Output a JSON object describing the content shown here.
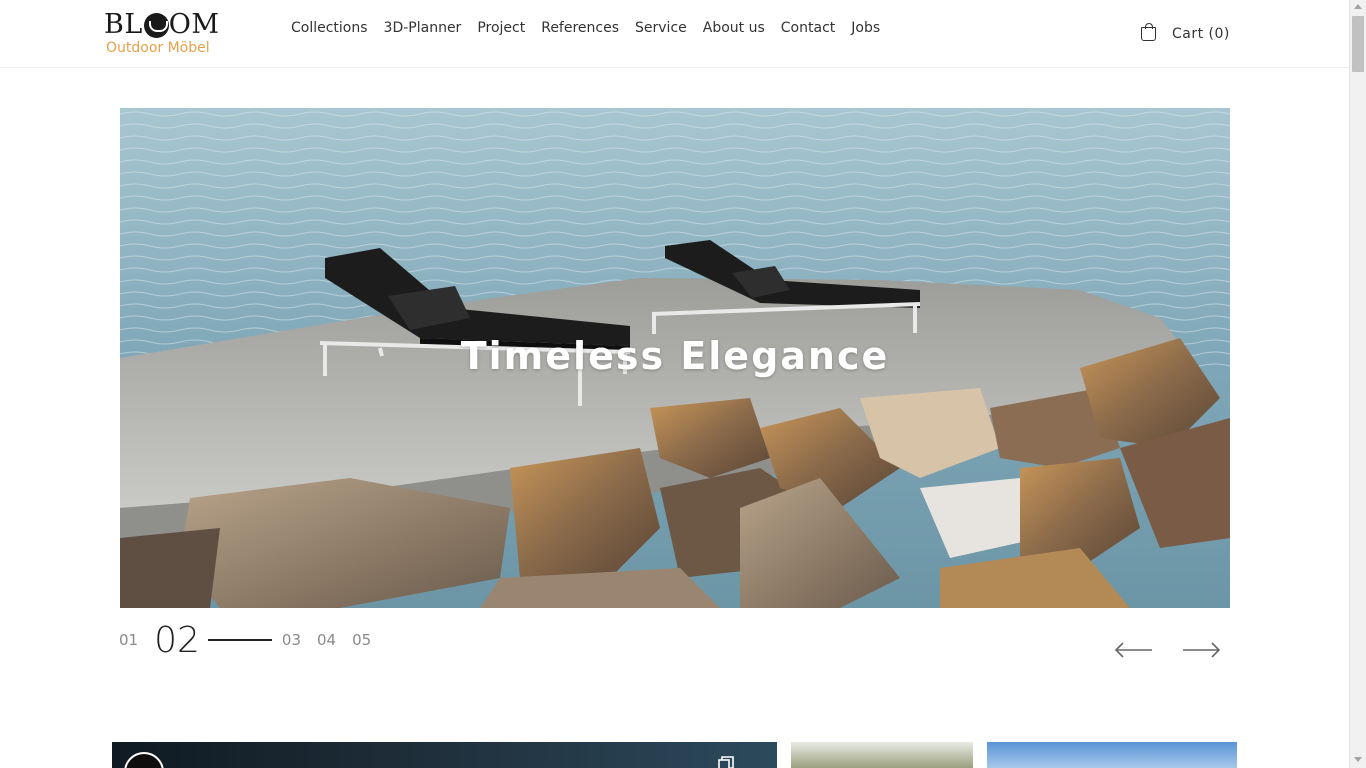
{
  "brand": {
    "name": "BLOOM",
    "name_left": "BL",
    "name_right": "OM",
    "tagline": "Outdoor Möbel",
    "accent_color": "#e6a24a"
  },
  "nav": {
    "items": [
      {
        "label": "Collections"
      },
      {
        "label": "3D-Planner"
      },
      {
        "label": "Project"
      },
      {
        "label": "References"
      },
      {
        "label": "Service"
      },
      {
        "label": "About us"
      },
      {
        "label": "Contact"
      },
      {
        "label": "Jobs"
      }
    ]
  },
  "cart": {
    "icon": "shopping-bag-icon",
    "label": "Cart (0)"
  },
  "hero": {
    "title": "Timeless Elegance",
    "image_alt": "Two black sun loungers on a stone pier by the sea"
  },
  "slider": {
    "slides": [
      "01",
      "02",
      "03",
      "04",
      "05"
    ],
    "active": "02",
    "prev_icon": "arrow-left-icon",
    "next_icon": "arrow-right-icon"
  }
}
